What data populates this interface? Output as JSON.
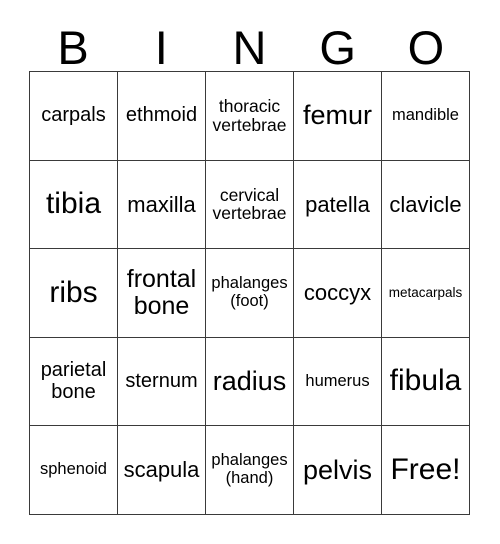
{
  "header": {
    "letters": [
      "B",
      "I",
      "N",
      "G",
      "O"
    ]
  },
  "grid": {
    "columns": 5,
    "rows": 5,
    "cells": [
      {
        "text": "carpals",
        "size": "s-md"
      },
      {
        "text": "ethmoid",
        "size": "s-md"
      },
      {
        "text": "thoracic\nvertebrae",
        "size": "s-smb"
      },
      {
        "text": "femur",
        "size": "s-xl"
      },
      {
        "text": "mandible",
        "size": "s-sm"
      },
      {
        "text": "tibia",
        "size": "s-xxl"
      },
      {
        "text": "maxilla",
        "size": "s-mdl"
      },
      {
        "text": "cervical\nvertebrae",
        "size": "s-smb"
      },
      {
        "text": "patella",
        "size": "s-mdl"
      },
      {
        "text": "clavicle",
        "size": "s-mdl"
      },
      {
        "text": "ribs",
        "size": "s-xxl"
      },
      {
        "text": "frontal\nbone",
        "size": "s-lg"
      },
      {
        "text": "phalanges\n(foot)",
        "size": "s-sm"
      },
      {
        "text": "coccyx",
        "size": "s-mdl"
      },
      {
        "text": "metacarpals",
        "size": "s-xs"
      },
      {
        "text": "parietal\nbone",
        "size": "s-md"
      },
      {
        "text": "sternum",
        "size": "s-md"
      },
      {
        "text": "radius",
        "size": "s-xl"
      },
      {
        "text": "humerus",
        "size": "s-sm"
      },
      {
        "text": "fibula",
        "size": "s-xxl"
      },
      {
        "text": "sphenoid",
        "size": "s-sm"
      },
      {
        "text": "scapula",
        "size": "s-mdl"
      },
      {
        "text": "phalanges\n(hand)",
        "size": "s-sm"
      },
      {
        "text": "pelvis",
        "size": "s-xl"
      },
      {
        "text": "Free!",
        "size": "s-xxl"
      }
    ]
  },
  "colors": {
    "background": "#ffffff",
    "border": "#3a3a3a",
    "text": "#000000"
  }
}
